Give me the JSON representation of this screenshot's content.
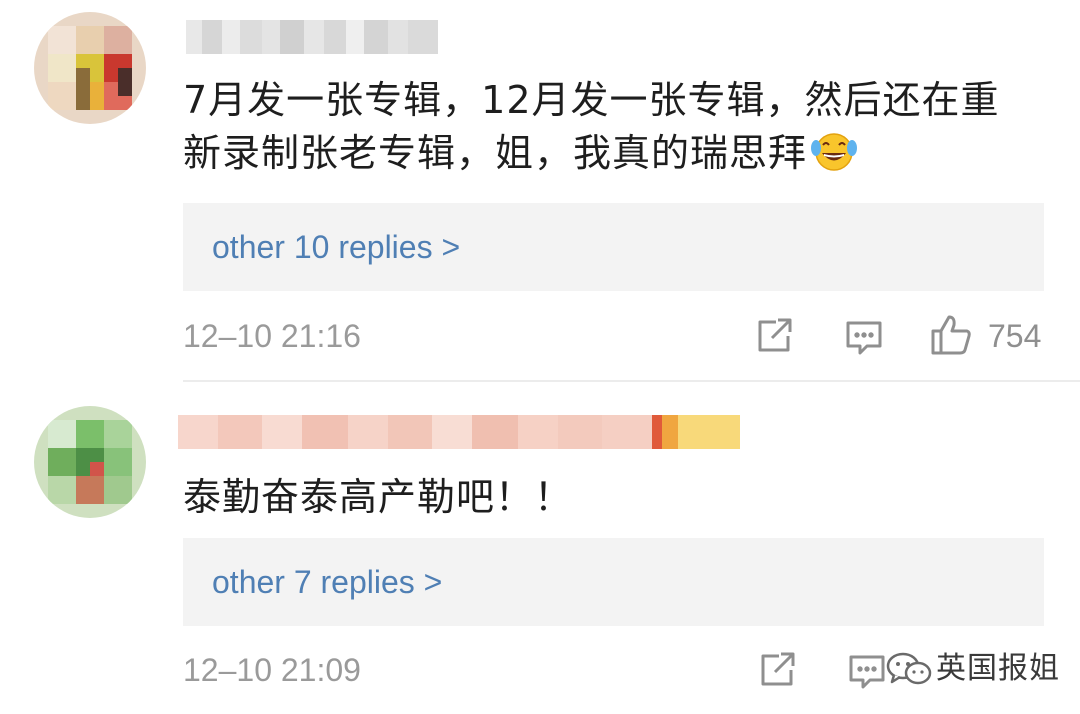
{
  "comments": [
    {
      "text_line1": "7月发一张专辑，12月发一张专辑，然后还在重",
      "text_line2": "新录制张老专辑，姐，我真的瑞思拜",
      "replies_label": "other 10 replies >",
      "timestamp": "12–10 21:16",
      "like_count": "754"
    },
    {
      "text_line1": "泰勤奋泰高产勒吧！！",
      "replies_label": "other 7 replies >",
      "timestamp": "12–10 21:09"
    }
  ],
  "icons": {
    "share": "share-icon",
    "comment": "comment-icon",
    "like": "thumbs-up-icon",
    "emoji": "laughing-tears-emoji",
    "watermark_logo": "wechat-icon"
  },
  "watermark": {
    "text": "英国报姐"
  },
  "colors": {
    "reply_link": "#4f7fb4",
    "meta_text": "#9a9a9a",
    "reply_box_bg": "#f3f3f3",
    "comment_text": "#1e1e1e"
  }
}
